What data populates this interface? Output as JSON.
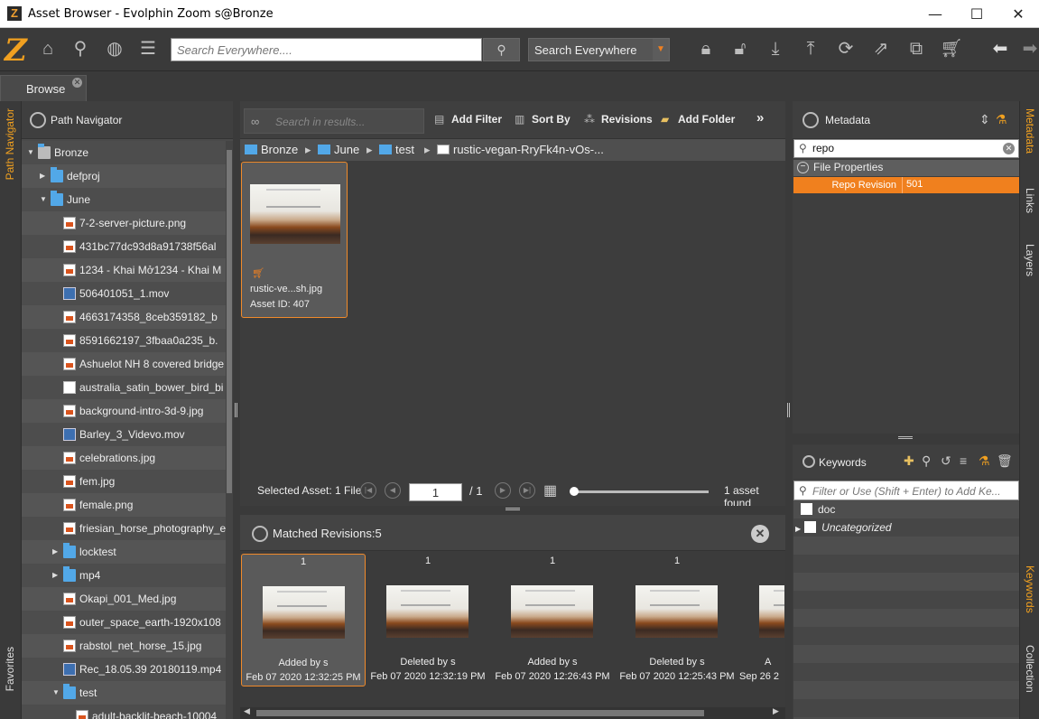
{
  "window": {
    "title": "Asset Browser - Evolphin Zoom s@Bronze",
    "minimize": "—",
    "maximize": "☐",
    "close": "✕"
  },
  "toolbar": {
    "search_placeholder": "Search Everywhere....",
    "scope": "Search Everywhere",
    "icons": [
      "home-icon",
      "search-icon",
      "globe-icon",
      "list-icon",
      "lock-icon",
      "unlock-icon",
      "download-icon",
      "upload-icon",
      "sync-icon",
      "share-icon",
      "compare-icon",
      "cart-icon",
      "back-arrow-icon",
      "forward-arrow-icon"
    ]
  },
  "tabs": [
    {
      "label": "Browse"
    }
  ],
  "left_strip": {
    "path_navigator": "Path Navigator",
    "favorites": "Favorites"
  },
  "path_navigator": {
    "title": "Path Navigator",
    "tree": [
      {
        "label": "Bronze",
        "type": "root",
        "arrow": "▼",
        "indent": 0
      },
      {
        "label": "defproj",
        "type": "folder",
        "arrow": "▶",
        "indent": 1
      },
      {
        "label": "June",
        "type": "folder",
        "arrow": "▼",
        "indent": 1
      },
      {
        "label": "7-2-server-picture.png",
        "type": "image",
        "indent": 2
      },
      {
        "label": "431bc77dc93d8a91738f56al",
        "type": "image",
        "indent": 2
      },
      {
        "label": "1234 - Khai Mở1234 - Khai M",
        "type": "image",
        "indent": 2
      },
      {
        "label": "506401051_1.mov",
        "type": "movie",
        "indent": 2
      },
      {
        "label": "4663174358_8ceb359182_b",
        "type": "image",
        "indent": 2
      },
      {
        "label": "8591662197_3fbaa0a235_b.",
        "type": "image",
        "indent": 2
      },
      {
        "label": "Ashuelot NH 8 covered bridge",
        "type": "image",
        "indent": 2
      },
      {
        "label": "australia_satin_bower_bird_bi",
        "type": "doc",
        "indent": 2
      },
      {
        "label": "background-intro-3d-9.jpg",
        "type": "image",
        "indent": 2
      },
      {
        "label": "Barley_3_Videvo.mov",
        "type": "movie",
        "indent": 2
      },
      {
        "label": "celebrations.jpg",
        "type": "image",
        "indent": 2
      },
      {
        "label": "fem.jpg",
        "type": "image",
        "indent": 2
      },
      {
        "label": "female.png",
        "type": "image",
        "indent": 2
      },
      {
        "label": "friesian_horse_photography_e",
        "type": "image",
        "indent": 2
      },
      {
        "label": "locktest",
        "type": "folder",
        "arrow": "▶",
        "indent": 2
      },
      {
        "label": "mp4",
        "type": "folder",
        "arrow": "▶",
        "indent": 2
      },
      {
        "label": "Okapi_001_Med.jpg",
        "type": "image",
        "indent": 2
      },
      {
        "label": "outer_space_earth-1920x108",
        "type": "image",
        "indent": 2
      },
      {
        "label": "rabstol_net_horse_15.jpg",
        "type": "image",
        "indent": 2
      },
      {
        "label": "Rec_18.05.39 20180119.mp4",
        "type": "movie",
        "indent": 2
      },
      {
        "label": "test",
        "type": "folder",
        "arrow": "▼",
        "indent": 2
      },
      {
        "label": "adult-backlit-beach-10004",
        "type": "image",
        "indent": 3
      }
    ]
  },
  "center": {
    "results_placeholder": "Search in results...",
    "buttons": {
      "add_filter": "Add Filter",
      "sort_by": "Sort By",
      "revisions": "Revisions",
      "add_folder": "Add Folder",
      "more": "»"
    },
    "breadcrumb": [
      "Bronze",
      "June",
      "test",
      "rustic-vegan-RryFk4n-vOs-..."
    ],
    "asset": {
      "name": "rustic-ve...sh.jpg",
      "id_label": "Asset ID: 407"
    },
    "pager": {
      "selected": "Selected Asset: 1 File",
      "page": "1",
      "of": "/ 1",
      "found": "1 asset found"
    },
    "revisions": {
      "title": "Matched Revisions:5",
      "items": [
        {
          "num": "1",
          "action": "Added by s",
          "date": "Feb 07 2020 12:32:25 PM"
        },
        {
          "num": "1",
          "action": "Deleted by s",
          "date": "Feb 07 2020 12:32:19 PM"
        },
        {
          "num": "1",
          "action": "Added by s",
          "date": "Feb 07 2020 12:26:43 PM"
        },
        {
          "num": "1",
          "action": "Deleted by s",
          "date": "Feb 07 2020 12:25:43 PM"
        },
        {
          "num": "",
          "action": "A",
          "date": "Sep 26 2"
        }
      ]
    }
  },
  "metadata": {
    "title": "Metadata",
    "search_value": "repo",
    "section": "File Properties",
    "field_label": "Repo Revision",
    "field_value": "501"
  },
  "keywords": {
    "title": "Keywords",
    "placeholder": "Filter or Use (Shift + Enter) to Add Ke...",
    "items": [
      "doc",
      "Uncategorized"
    ]
  },
  "right_strip": {
    "metadata": "Metadata",
    "links": "Links",
    "layers": "Layers",
    "keywords": "Keywords",
    "collection": "Collection"
  },
  "colors": {
    "accent": "#f08020",
    "folder": "#52a8e8",
    "panel": "#4a4a4a"
  }
}
